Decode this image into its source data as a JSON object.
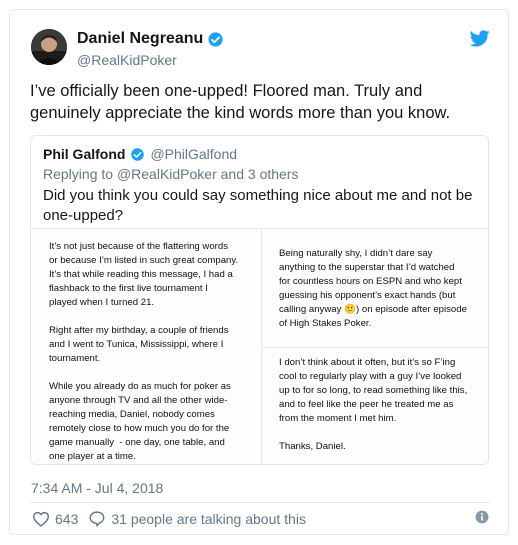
{
  "author": {
    "name": "Daniel Negreanu",
    "handle": "@RealKidPoker",
    "avatar": "avatar-photo"
  },
  "tweet": {
    "text": "I’ve officially been one-upped! Floored man. Truly and genuinely appreciate the kind words more than you know.",
    "timestamp": "7:34 AM - Jul 4, 2018",
    "likes": "643",
    "conversation": "31 people are talking about this"
  },
  "quoted": {
    "name": "Phil Galfond",
    "handle": "@PhilGalfond",
    "reply_prefix": "Replying to ",
    "reply_to": "@RealKidPoker and 3 others",
    "text": "Did you think you could say something nice about me and not be one-upped?",
    "images": {
      "left": "It’s not just because of the flattering words\nor because I’m listed in such great company.\nIt’s that while reading this message, I had a\nflashback to the first live tournament I\nplayed when I turned 21.\n\nRight after my birthday, a couple of friends\nand I went to Tunica, Mississippi, where I\ntournament.\n\nWhile you already do as much for poker as\nanyone through TV and all the other wide-\nreaching media, Daniel, nobody comes\nremotely close to how much you do for the\ngame manually  - one day, one table, and\none player at a time.",
      "right_top": "Being naturally shy, I didn’t dare say\nanything to the superstar that I’d watched\nfor countless hours on ESPN and who kept\nguessing his opponent’s exact hands (but\ncalling anyway 🙂) on episode after episode\nof High Stakes Poker.",
      "right_bottom": "I don’t think about it often, but it’s so F’ing\ncool to regularly play with a guy I’ve looked\nup to for so long, to read something like this,\nand to feel like the peer he treated me as\nfrom the moment I met him.\n\nThanks, Daniel."
    }
  },
  "icons": {
    "verified": "verified-badge-icon",
    "twitter": "twitter-bird-icon",
    "like": "heart-icon",
    "reply": "comment-icon",
    "info": "info-icon"
  },
  "colors": {
    "twitter_blue": "#1da1f2",
    "secondary_text": "#657786",
    "border": "#e1e8ed"
  }
}
